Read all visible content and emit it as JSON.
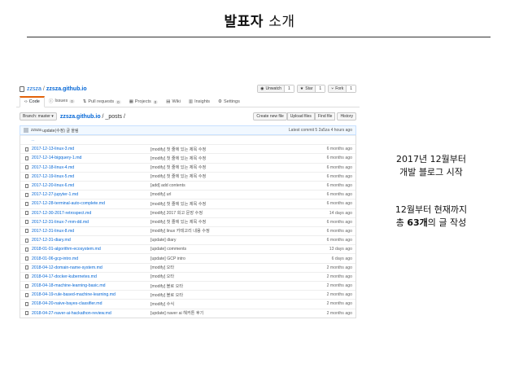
{
  "slide": {
    "title_bold": "발표자",
    "title_rest": "소개",
    "side_top": [
      "2017년 12월부터",
      "개발 블로그 시작"
    ],
    "side_bottom_line1": "12월부터 현재까지",
    "side_bottom_prefix": "총 ",
    "side_bottom_count": "63개",
    "side_bottom_suffix": "의 글 작성"
  },
  "github": {
    "owner": "zzsza",
    "sep": "/",
    "repo": "zzsza.github.io",
    "actions": [
      {
        "label": "Unwatch",
        "count": "1"
      },
      {
        "label": "Star",
        "count": "1"
      },
      {
        "label": "Fork",
        "count": "1"
      }
    ],
    "tabs": [
      {
        "label": "Code",
        "badge": ""
      },
      {
        "label": "Issues",
        "badge": "0"
      },
      {
        "label": "Pull requests",
        "badge": "0"
      },
      {
        "label": "Projects",
        "badge": "0"
      },
      {
        "label": "Wiki",
        "badge": ""
      },
      {
        "label": "Insights",
        "badge": ""
      },
      {
        "label": "Settings",
        "badge": ""
      }
    ],
    "branch": "Branch: master ▾",
    "path_root": "zzsza.github.io",
    "path_rest": " / _posts /",
    "toolbar": [
      "Create new file",
      "Upload files",
      "Find file",
      "History"
    ],
    "commit_author": "zzsza",
    "commit_message": "update(수정) 글 올림",
    "commit_latest": "Latest commit 5 2a5za 4 hours ago",
    "files": [
      {
        "name": "..",
        "msg": "",
        "age": ""
      },
      {
        "name": "2017-12-13-linux-3.md",
        "msg": "[modify] 첫 줄에 있는 제목 수정",
        "age": "6 months ago"
      },
      {
        "name": "2017-12-14-bigquery-1.md",
        "msg": "[modify] 첫 줄에 있는 제목 수정",
        "age": "6 months ago"
      },
      {
        "name": "2017-12-18-linux-4.md",
        "msg": "[modify] 첫 줄에 있는 제목 수정",
        "age": "6 months ago"
      },
      {
        "name": "2017-12-19-linux-5.md",
        "msg": "[modify] 첫 줄에 있는 제목 수정",
        "age": "6 months ago"
      },
      {
        "name": "2017-12-20-linux-6.md",
        "msg": "[add] add contents",
        "age": "6 months ago"
      },
      {
        "name": "2017-12-27-jupyter-1.md",
        "msg": "[modify] url",
        "age": "6 months ago"
      },
      {
        "name": "2017-12-28-terminal-auto-complete.md",
        "msg": "[modify] 첫 줄에 있는 제목 수정",
        "age": "6 months ago"
      },
      {
        "name": "2017-12-30-2017-retrospect.md",
        "msg": "[modify] 2017 회고 문장 수정",
        "age": "14 days ago"
      },
      {
        "name": "2017-12-31-linux-7-mm-dd.md",
        "msg": "[modify] 첫 줄에 있는 제목 수정",
        "age": "6 months ago"
      },
      {
        "name": "2017-12-31-linux-8.md",
        "msg": "[modify] linux 카테고리 내용 수정",
        "age": "6 months ago"
      },
      {
        "name": "2017-12-31-diary.md",
        "msg": "[update] diary",
        "age": "6 months ago"
      },
      {
        "name": "2018-01-01-algorithm-ecosystem.md",
        "msg": "[update] comments",
        "age": "13 days ago"
      },
      {
        "name": "2018-01-06-gcp-intro.md",
        "msg": "[update] GCP intro",
        "age": "6 days ago"
      },
      {
        "name": "2018-04-12-domain-name-system.md",
        "msg": "[modify] 오타",
        "age": "2 months ago"
      },
      {
        "name": "2018-04-17-docker-kubernetes.md",
        "msg": "[modify] 오타",
        "age": "2 months ago"
      },
      {
        "name": "2018-04-18-machine-learning-basic.md",
        "msg": "[modify] 블로 오타",
        "age": "2 months ago"
      },
      {
        "name": "2018-04-19-rule-based-machine-learning.md",
        "msg": "[modify] 블로 오타",
        "age": "2 months ago"
      },
      {
        "name": "2018-04-20-naive-bayes-classifier.md",
        "msg": "[modify] 수식",
        "age": "2 months ago"
      },
      {
        "name": "2018-04-27-naver-ai-hackathon-review.md",
        "msg": "[update] naver ai 해커톤 후기",
        "age": "2 months ago"
      }
    ]
  }
}
